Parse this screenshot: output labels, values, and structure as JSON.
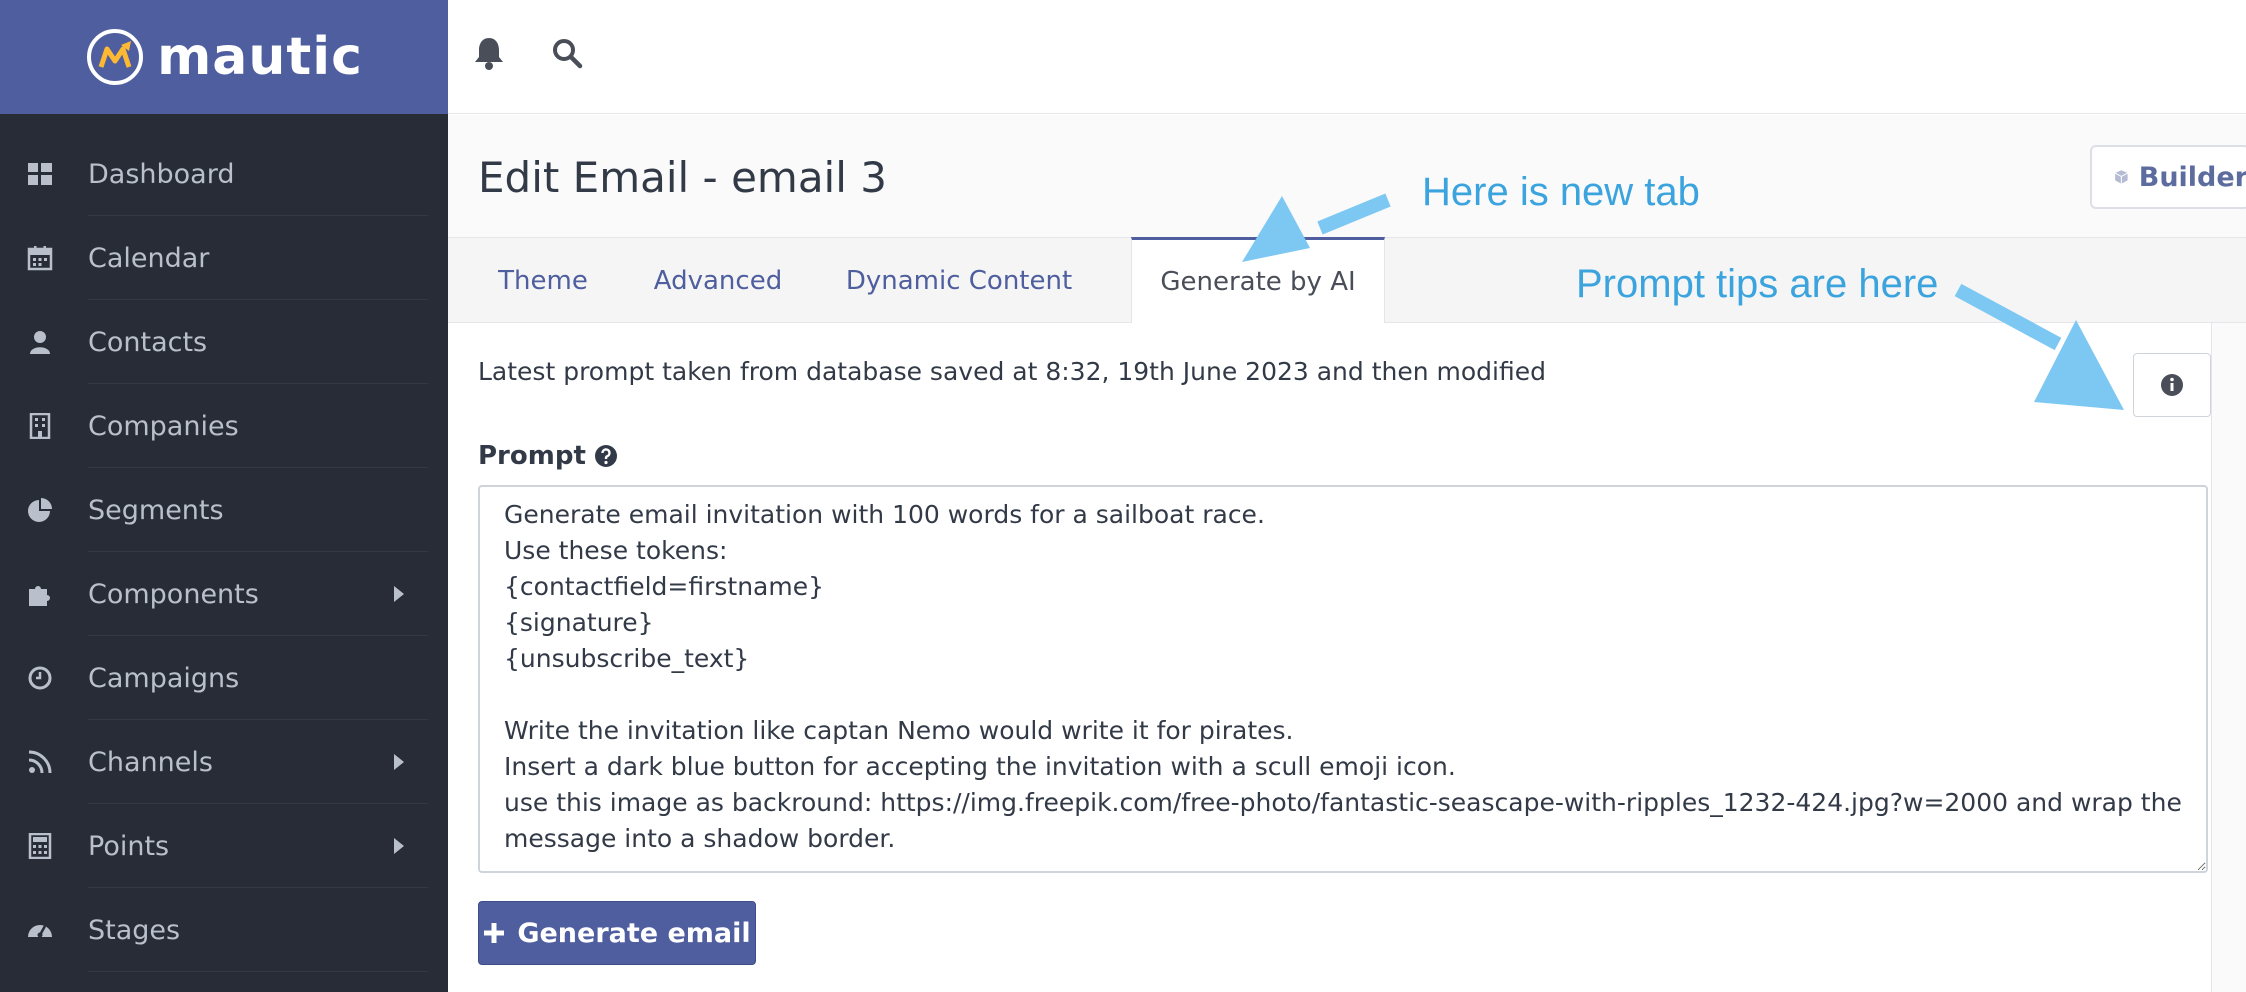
{
  "brand": {
    "name": "mautic"
  },
  "sidebar": {
    "items": [
      {
        "label": "Dashboard",
        "icon": "dashboard-icon",
        "has_submenu": false
      },
      {
        "label": "Calendar",
        "icon": "calendar-icon",
        "has_submenu": false
      },
      {
        "label": "Contacts",
        "icon": "user-icon",
        "has_submenu": false
      },
      {
        "label": "Companies",
        "icon": "building-icon",
        "has_submenu": false
      },
      {
        "label": "Segments",
        "icon": "pie-chart-icon",
        "has_submenu": false
      },
      {
        "label": "Components",
        "icon": "puzzle-icon",
        "has_submenu": true
      },
      {
        "label": "Campaigns",
        "icon": "clock-icon",
        "has_submenu": false
      },
      {
        "label": "Channels",
        "icon": "rss-icon",
        "has_submenu": true
      },
      {
        "label": "Points",
        "icon": "calculator-icon",
        "has_submenu": true
      },
      {
        "label": "Stages",
        "icon": "tachometer-icon",
        "has_submenu": false
      }
    ]
  },
  "topbar": {
    "icons": [
      "bell-icon",
      "search-icon"
    ]
  },
  "page": {
    "title": "Edit Email - email 3",
    "builder_label": "Builder"
  },
  "tabs": [
    {
      "label": "Theme",
      "active": false
    },
    {
      "label": "Advanced",
      "active": false
    },
    {
      "label": "Dynamic Content",
      "active": false
    },
    {
      "label": "Generate by AI",
      "active": true
    }
  ],
  "panel": {
    "status_text": "Latest prompt taken from database saved at 8:32, 19th June 2023 and then modified",
    "prompt_label": "Prompt",
    "prompt_value": "Generate email invitation with 100 words for a sailboat race.\nUse these tokens:\n{contactfield=firstname}\n{signature}\n{unsubscribe_text}\n\nWrite the invitation like captan Nemo would write it for pirates.\nInsert a dark blue button for accepting the invitation with a scull emoji icon.\nuse this image as backround: https://img.freepik.com/free-photo/fantastic-seascape-with-ripples_1232-424.jpg?w=2000 and wrap the message into a shadow border.",
    "generate_button": "Generate email"
  },
  "annotations": {
    "new_tab": "Here is new tab",
    "prompt_tips": "Prompt tips are here"
  },
  "colors": {
    "brand": "#4e5e9e",
    "sidebar_bg": "#272c37",
    "annotation": "#3ba3dd",
    "arrow": "#7cc8f3"
  }
}
